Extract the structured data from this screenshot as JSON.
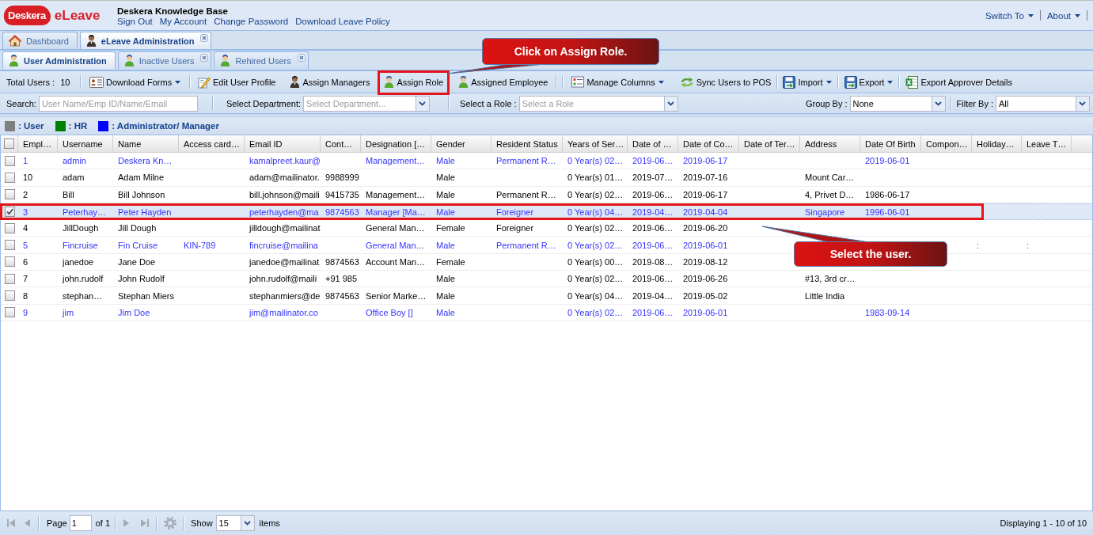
{
  "header": {
    "logo": {
      "brand": "Deskera",
      "product": "eLeave"
    },
    "title": "Deskera Knowledge Base",
    "links": [
      "Sign Out",
      "My Account",
      "Change Password",
      "Download Leave Policy"
    ],
    "menus": [
      "Switch To",
      "About"
    ]
  },
  "main_tabs": [
    {
      "label": "Dashboard",
      "selected": false,
      "closable": false
    },
    {
      "label": "eLeave Administration",
      "selected": true,
      "closable": true
    }
  ],
  "sub_tabs": [
    {
      "label": "User Administration",
      "selected": true,
      "closable": false
    },
    {
      "label": "Inactive Users",
      "selected": false,
      "closable": true
    },
    {
      "label": "Rehired Users",
      "selected": false,
      "closable": true
    }
  ],
  "toolbar": {
    "total_label": "Total Users :",
    "total": "10",
    "buttons": [
      {
        "label": "Download Forms",
        "menu": true
      },
      {
        "label": "Edit User Profile",
        "menu": false
      },
      {
        "label": "Assign Managers",
        "menu": false
      },
      {
        "label": "Assign Role",
        "menu": false
      },
      {
        "label": "Assigned Employee",
        "menu": false
      },
      {
        "label": "Manage Columns",
        "menu": true
      },
      {
        "label": "Sync Users to POS",
        "menu": false
      },
      {
        "label": "Import",
        "menu": true
      },
      {
        "label": "Export",
        "menu": true
      },
      {
        "label": "Export Approver Details",
        "menu": false
      }
    ]
  },
  "filters": {
    "search": {
      "label": "Search:",
      "placeholder": "User Name/Emp ID/Name/Email"
    },
    "department": {
      "label": "Select Department:",
      "placeholder": "Select Department..."
    },
    "role": {
      "label": "Select a Role :",
      "placeholder": "Select a Role"
    },
    "group_by": {
      "label": "Group By :",
      "value": "None"
    },
    "filter_by": {
      "label": "Filter By :",
      "value": "All"
    }
  },
  "legend": [
    {
      "label": ": User",
      "color": "#808080"
    },
    {
      "label": ": HR",
      "color": "#008000"
    },
    {
      "label": ": Administrator/ Manager",
      "color": "#0000ff"
    }
  ],
  "table": {
    "all_selected": false,
    "columns": [
      "Empl…",
      "Username",
      "Name",
      "Access card…",
      "Email ID",
      "Cont…",
      "Designation […",
      "Gender",
      "Resident Status",
      "Years of Ser…",
      "Date of …",
      "Date of Co…",
      "Date of Ter…",
      "Address",
      "Date Of Birth",
      "Compon…",
      "Holiday…",
      "Leave T…"
    ],
    "rows": [
      {
        "selected": false,
        "color": "#3333ff",
        "cells": [
          "1",
          "admin",
          "Deskera Kn…",
          null,
          "kamalpreet.kaur@",
          null,
          "Management…",
          "Male",
          "Permanent R…",
          "0 Year(s) 02…",
          "2019-06…",
          "2019-06-17",
          null,
          null,
          "2019-06-01",
          null,
          null,
          null
        ]
      },
      {
        "selected": false,
        "color": "#000000",
        "cells": [
          "10",
          "adam",
          "Adam Milne",
          null,
          "adam@mailinator.",
          "9988999",
          null,
          "Male",
          null,
          "0 Year(s) 01…",
          "2019-07…",
          "2019-07-16",
          null,
          "Mount Car…",
          null,
          null,
          null,
          null
        ]
      },
      {
        "selected": false,
        "color": "#000000",
        "cells": [
          "2",
          "Bill",
          "Bill Johnson",
          null,
          "bill.johnson@maili",
          "9415735",
          "Management…",
          "Male",
          "Permanent R…",
          "0 Year(s) 02…",
          "2019-06…",
          "2019-06-17",
          null,
          "4, Privet D…",
          "1986-06-17",
          null,
          null,
          null
        ]
      },
      {
        "selected": true,
        "color": "#3333ff",
        "cells": [
          "3",
          "Peterhay…",
          "Peter Hayden",
          null,
          "peterhayden@ma",
          "9874563",
          "Manager [Ma…",
          "Male",
          "Foreigner",
          "0 Year(s) 04…",
          "2019-04…",
          "2019-04-04",
          null,
          "Singapore",
          "1996-06-01",
          null,
          null,
          null
        ]
      },
      {
        "selected": false,
        "color": "#000000",
        "cells": [
          "4",
          "JillDough",
          "Jill Dough",
          null,
          "jilldough@mailinat",
          null,
          "General Man…",
          "Female",
          "Foreigner",
          "0 Year(s) 02…",
          "2019-06…",
          "2019-06-20",
          null,
          null,
          null,
          null,
          null,
          null
        ]
      },
      {
        "selected": false,
        "color": "#3333ff",
        "cells": [
          "5",
          "Fincruise",
          "Fin Cruise",
          "KIN-789",
          "fincruise@mailina",
          null,
          "General Man…",
          "Male",
          "Permanent R…",
          "0 Year(s) 02…",
          "2019-06…",
          "2019-06-01",
          null,
          null,
          null,
          null,
          ":",
          ":"
        ]
      },
      {
        "selected": false,
        "color": "#000000",
        "cells": [
          "6",
          "janedoe",
          "Jane Doe",
          null,
          "janedoe@mailinat",
          "9874563",
          "Account Man…",
          "Female",
          null,
          "0 Year(s) 00…",
          "2019-08…",
          "2019-08-12",
          null,
          null,
          null,
          null,
          null,
          null
        ]
      },
      {
        "selected": false,
        "color": "#000000",
        "cells": [
          "7",
          "john.rudolf",
          "John Rudolf",
          null,
          "john.rudolf@maili",
          "+91 985",
          null,
          "Male",
          null,
          "0 Year(s) 02…",
          "2019-06…",
          "2019-06-26",
          null,
          "#13, 3rd cr…",
          null,
          null,
          null,
          null
        ]
      },
      {
        "selected": false,
        "color": "#000000",
        "cells": [
          "8",
          "stephan…",
          "Stephan Miers",
          null,
          "stephanmiers@de",
          "9874563",
          "Senior Marke…",
          "Male",
          null,
          "0 Year(s) 04…",
          "2019-04…",
          "2019-05-02",
          null,
          "Little India",
          null,
          null,
          null,
          null
        ]
      },
      {
        "selected": false,
        "color": "#3333ff",
        "cells": [
          "9",
          "jim",
          "Jim Doe",
          null,
          "jim@mailinator.co",
          null,
          "Office Boy []",
          "Male",
          null,
          "0 Year(s) 02…",
          "2019-06…",
          "2019-06-01",
          null,
          null,
          "1983-09-14",
          null,
          null,
          null
        ]
      }
    ]
  },
  "paging": {
    "page_label": "Page",
    "page": "1",
    "page_count": "of 1",
    "show_label": "Show",
    "page_size": "15",
    "items_label": "items",
    "summary": "Displaying 1 - 10 of 10"
  },
  "annotations": [
    {
      "text": "Click on Assign Role."
    },
    {
      "text": "Select the user."
    }
  ]
}
